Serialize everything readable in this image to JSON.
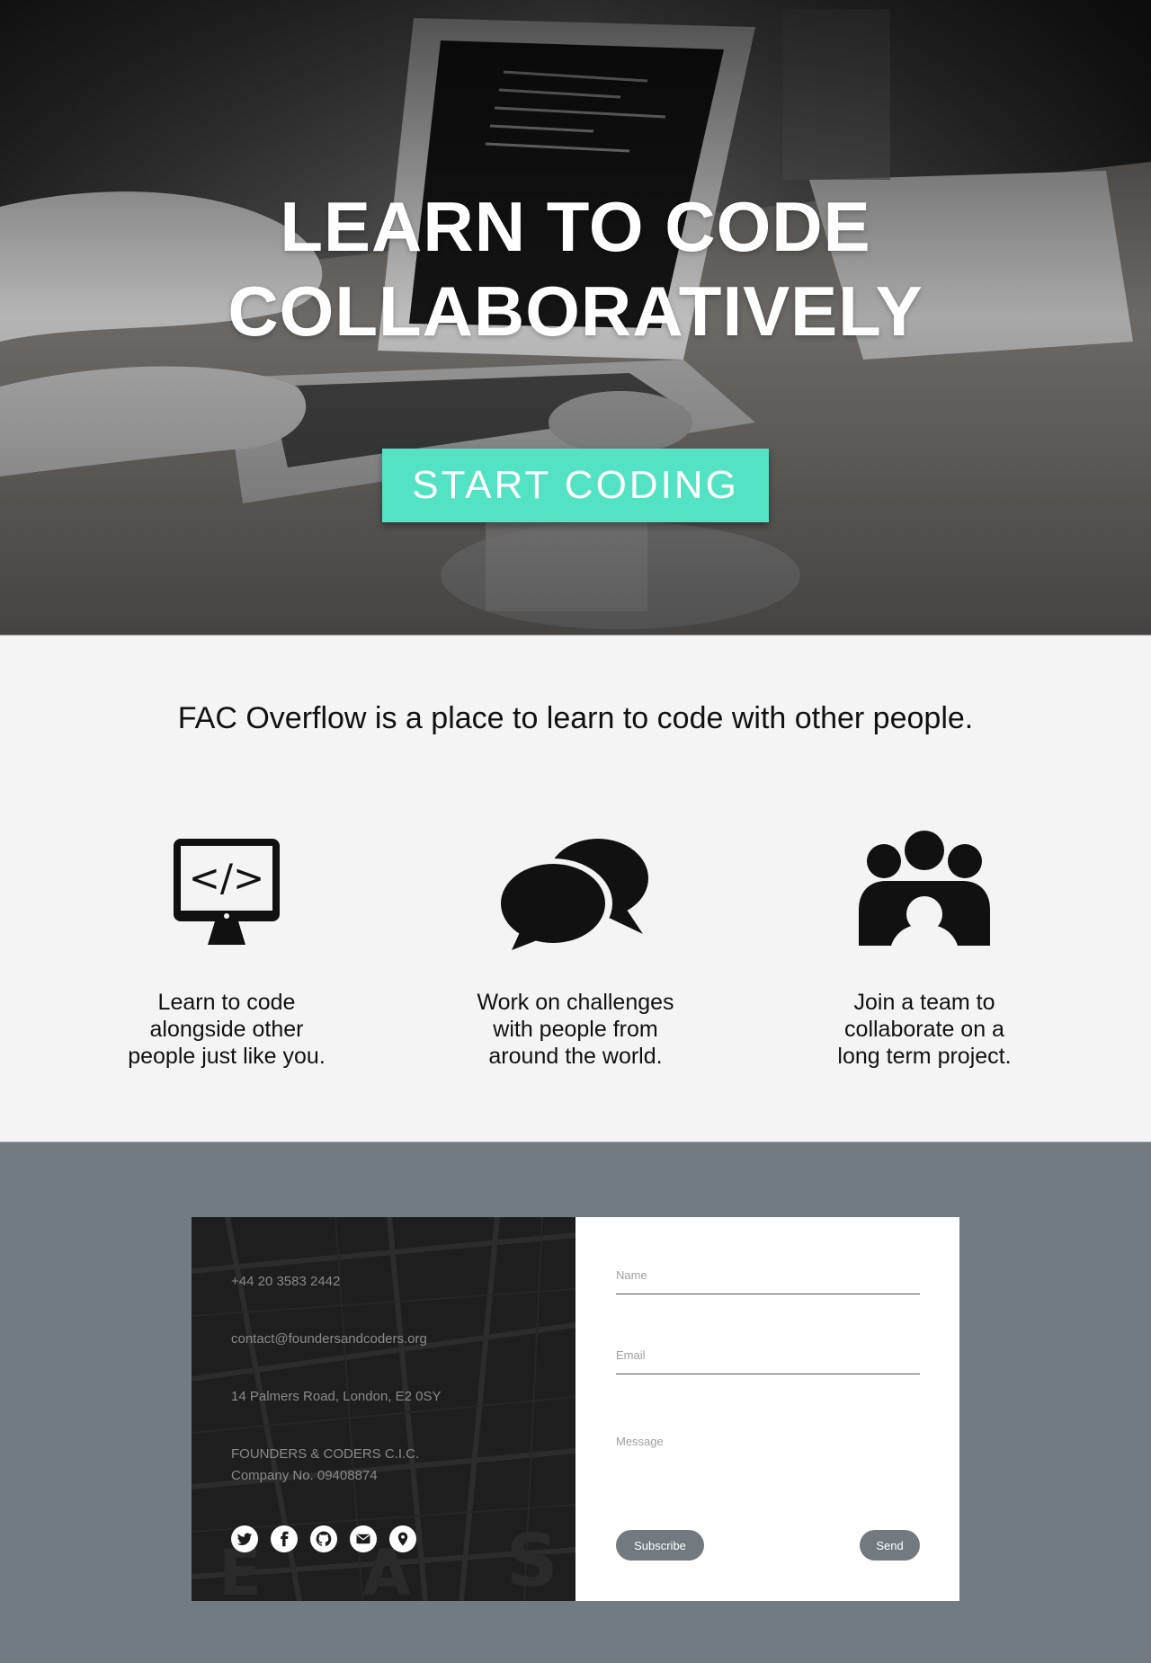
{
  "hero": {
    "title_line1": "LEARN TO CODE",
    "title_line2": "COLLABORATIVELY",
    "cta_label": "START CODING",
    "accent": "#54e2c4"
  },
  "intro": {
    "tagline": "FAC Overflow is a place to learn to code with other people."
  },
  "features": [
    {
      "icon": "code-monitor-icon",
      "lines": [
        "Learn to code",
        "alongside other",
        "people just like you."
      ]
    },
    {
      "icon": "chat-bubbles-icon",
      "lines": [
        "Work on challenges",
        "with people from",
        "around the world."
      ]
    },
    {
      "icon": "team-icon",
      "lines": [
        "Join a team to",
        "collaborate on a",
        "long term project."
      ]
    }
  ],
  "contact": {
    "phone": "+44 20 3583 2442",
    "email": "contact@foundersandcoders.org",
    "address": "14 Palmers Road, London, E2 0SY",
    "company_line1": "FOUNDERS & CODERS C.I.C.",
    "company_line2": "Company No. 09408874",
    "socials": [
      "twitter-icon",
      "facebook-icon",
      "github-icon",
      "mail-icon",
      "location-pin-icon"
    ]
  },
  "form": {
    "name_placeholder": "Name",
    "email_placeholder": "Email",
    "message_placeholder": "Message",
    "subscribe_label": "Subscribe",
    "send_label": "Send"
  },
  "colors": {
    "footer_bg": "#737b82",
    "button_grey": "#727a80",
    "features_bg": "#f4f4f4"
  }
}
